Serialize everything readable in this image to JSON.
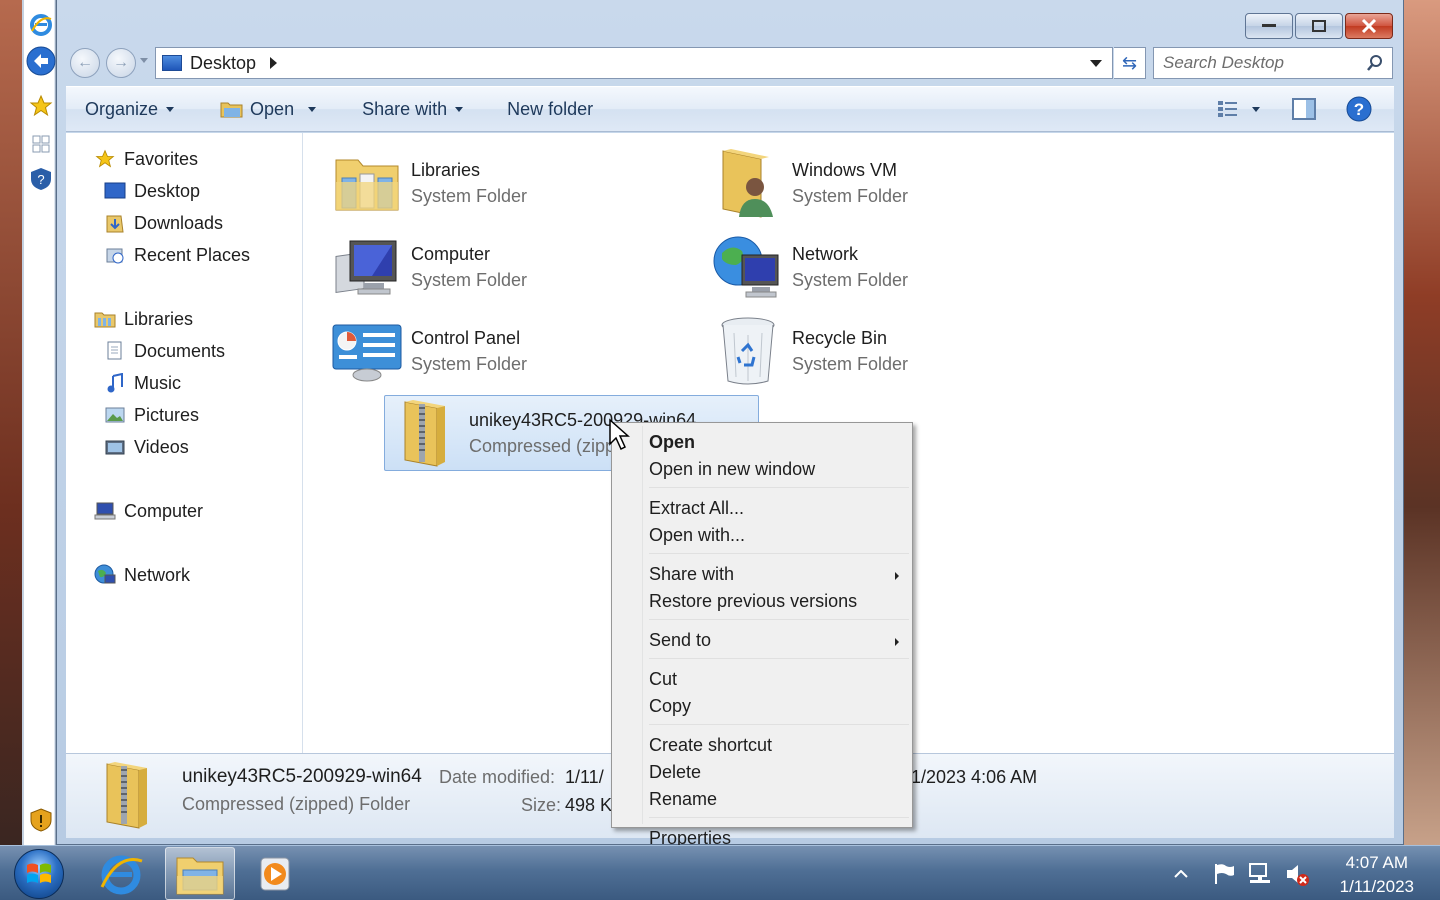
{
  "window": {
    "address": {
      "crumb": "Desktop"
    },
    "search": {
      "placeholder": "Search Desktop"
    }
  },
  "toolbar": {
    "organize": "Organize",
    "open": "Open",
    "share_with": "Share with",
    "new_folder": "New folder"
  },
  "nav": {
    "favorites": "Favorites",
    "desktop": "Desktop",
    "downloads": "Downloads",
    "recent_places": "Recent Places",
    "libraries": "Libraries",
    "documents": "Documents",
    "music": "Music",
    "pictures": "Pictures",
    "videos": "Videos",
    "computer": "Computer",
    "network": "Network"
  },
  "items": [
    {
      "name": "Libraries",
      "type": "System Folder",
      "icon": "libraries-icon"
    },
    {
      "name": "Windows VM",
      "type": "System Folder",
      "icon": "user-folder-icon"
    },
    {
      "name": "Computer",
      "type": "System Folder",
      "icon": "computer-icon"
    },
    {
      "name": "Network",
      "type": "System Folder",
      "icon": "network-icon"
    },
    {
      "name": "Control Panel",
      "type": "System Folder",
      "icon": "control-panel-icon"
    },
    {
      "name": "Recycle Bin",
      "type": "System Folder",
      "icon": "recycle-bin-icon"
    },
    {
      "name": "unikey43RC5-200929-win64",
      "type": "Compressed (zipped) Folder",
      "icon": "zip-folder-icon",
      "selected": true
    }
  ],
  "details": {
    "name": "unikey43RC5-200929-win64",
    "type": "Compressed (zipped) Folder",
    "date_modified_label": "Date modified:",
    "date_modified_value": "1/11/",
    "size_label": "Size:",
    "size_value": "498 K",
    "date_created_partial": "1/2023 4:06 AM"
  },
  "context_menu": {
    "open": "Open",
    "open_new_window": "Open in new window",
    "extract_all": "Extract All...",
    "open_with": "Open with...",
    "share_with": "Share with",
    "restore_previous": "Restore previous versions",
    "send_to": "Send to",
    "cut": "Cut",
    "copy": "Copy",
    "create_shortcut": "Create shortcut",
    "delete": "Delete",
    "rename": "Rename",
    "properties": "Properties"
  },
  "taskbar": {
    "time": "4:07 AM",
    "date": "1/11/2023"
  },
  "colors": {
    "selection": "#cce0f6",
    "accent": "#2f66b8",
    "close_button": "#c13a21"
  }
}
